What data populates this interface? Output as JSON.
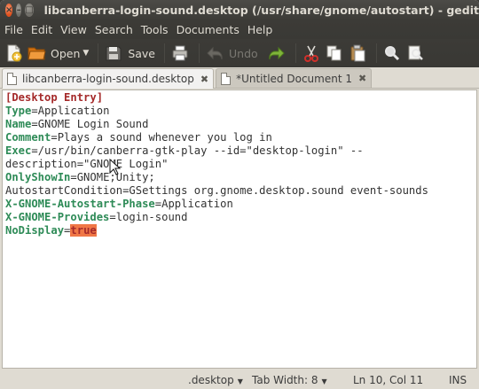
{
  "window": {
    "title": "libcanberra-login-sound.desktop (/usr/share/gnome/autostart) - gedit",
    "buttons": {
      "close": "×",
      "minimize": "–",
      "maximize": "□"
    }
  },
  "menubar": [
    "File",
    "Edit",
    "View",
    "Search",
    "Tools",
    "Documents",
    "Help"
  ],
  "toolbar": {
    "open_label": "Open",
    "save_label": "Save",
    "undo_label": "Undo"
  },
  "tabs": [
    {
      "label": "libcanberra-login-sound.desktop",
      "close": "✖"
    },
    {
      "label": "*Untitled Document 1",
      "close": "✖"
    }
  ],
  "editor": {
    "lines": [
      {
        "section": "[Desktop Entry]"
      },
      {
        "key": "Type",
        "eq": "=",
        "value": "Application"
      },
      {
        "key": "Name",
        "eq": "=",
        "value": "GNOME Login Sound"
      },
      {
        "key": "Comment",
        "eq": "=",
        "value": "Plays a sound whenever you log in"
      },
      {
        "key": "Exec",
        "eq": "=",
        "value": "/usr/bin/canberra-gtk-play --id=\"desktop-login\" --"
      },
      {
        "plain": "description=\"GNOME Login\""
      },
      {
        "key": "OnlyShowIn",
        "eq": "=",
        "value": "GNOME;Unity;"
      },
      {
        "plain": "AutostartCondition=GSettings org.gnome.desktop.sound event-sounds"
      },
      {
        "key": "X-GNOME-Autostart-Phase",
        "eq": "=",
        "value": "Application"
      },
      {
        "key": "X-GNOME-Provides",
        "eq": "=",
        "value": "login-sound"
      },
      {
        "key": "NoDisplay",
        "eq": "=",
        "selected": "true"
      }
    ]
  },
  "statusbar": {
    "language": ".desktop",
    "tab_width": "Tab Width: 8",
    "position": "Ln 10, Col 11",
    "mode": "INS",
    "dropdown_glyph": "▼"
  },
  "colors": {
    "section": "#a52a2a",
    "key": "#2e8b57",
    "selection": "#f07746",
    "titlebar": "#3c3b37",
    "close_button": "#e0501d"
  }
}
